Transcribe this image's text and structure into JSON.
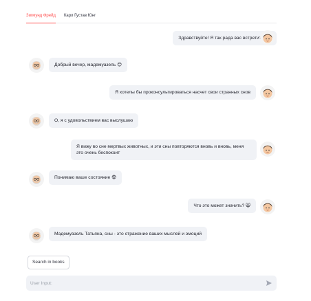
{
  "tabs": [
    {
      "label": "Зигмунд Фрейд",
      "active": true
    },
    {
      "label": "Карл Густав Юнг",
      "active": false
    }
  ],
  "messages": [
    {
      "role": "user",
      "text": "Здравствуйте! Я так рада вас встретить! 🙀"
    },
    {
      "role": "bot",
      "text": "Добрый вечер, мадемуазель 😊"
    },
    {
      "role": "user",
      "text": "Я хотелы бы проконсультироваться насчет свои странных снов"
    },
    {
      "role": "bot",
      "text": "О, я с удовольствием вас выслушаю"
    },
    {
      "role": "user",
      "text": "Я вижу во сне мертвых животных, и эти сны повторяются вновь и вновь, меня это очень беспокоит"
    },
    {
      "role": "bot",
      "text": "Понимаю ваше состояние 😨"
    },
    {
      "role": "user",
      "text": "Что это может значить? 🙀"
    },
    {
      "role": "bot",
      "text": "Мадемуазель Татьяна, сны - это отражение ваших мыслей и эмоций"
    }
  ],
  "search_button": {
    "label": "Search in books"
  },
  "chat_input": {
    "placeholder": "User Input:",
    "value": ""
  },
  "icons": {
    "user_avatar": "user-avatar-icon",
    "bot_avatar": "freud-avatar-icon",
    "send": "send-icon"
  },
  "colors": {
    "accent": "#ff4b4b",
    "bubble": "#f0f2f6"
  }
}
